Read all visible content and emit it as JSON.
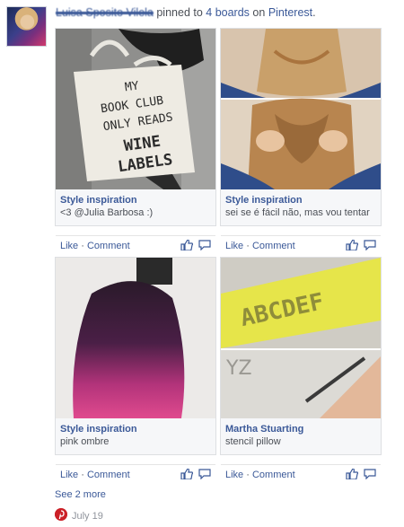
{
  "story": {
    "actor_name": "Luisa Sposito Vilela",
    "verb": "pinned to",
    "boards_link": "4 boards",
    "on_text": "on",
    "platform_link": "Pinterest",
    "period": "."
  },
  "pins": [
    {
      "title": "Style inspiration",
      "caption": "<3 @Julia Barbosa :)",
      "image_text": [
        "MY",
        "BOOK CLUB",
        "ONLY READS",
        "WINE",
        "LABELS"
      ]
    },
    {
      "title": "Style inspiration",
      "caption": "sei se é fácil não, mas vou tentar"
    },
    {
      "title": "Style inspiration",
      "caption": "pink ombre"
    },
    {
      "title": "Martha Stuarting",
      "caption": "stencil pillow",
      "image_text": [
        "ABCDEF",
        "YZ"
      ]
    }
  ],
  "actions": {
    "like": "Like",
    "separator": "·",
    "comment": "Comment"
  },
  "footer": {
    "see_more": "See 2 more",
    "date": "July 19"
  },
  "icons": {
    "like": "thumbs-up-icon",
    "comment": "speech-bubble-icon",
    "source": "pinterest-icon"
  },
  "colors": {
    "link": "#3b5998",
    "meta": "#90949c",
    "pinterest": "#cb2027"
  }
}
